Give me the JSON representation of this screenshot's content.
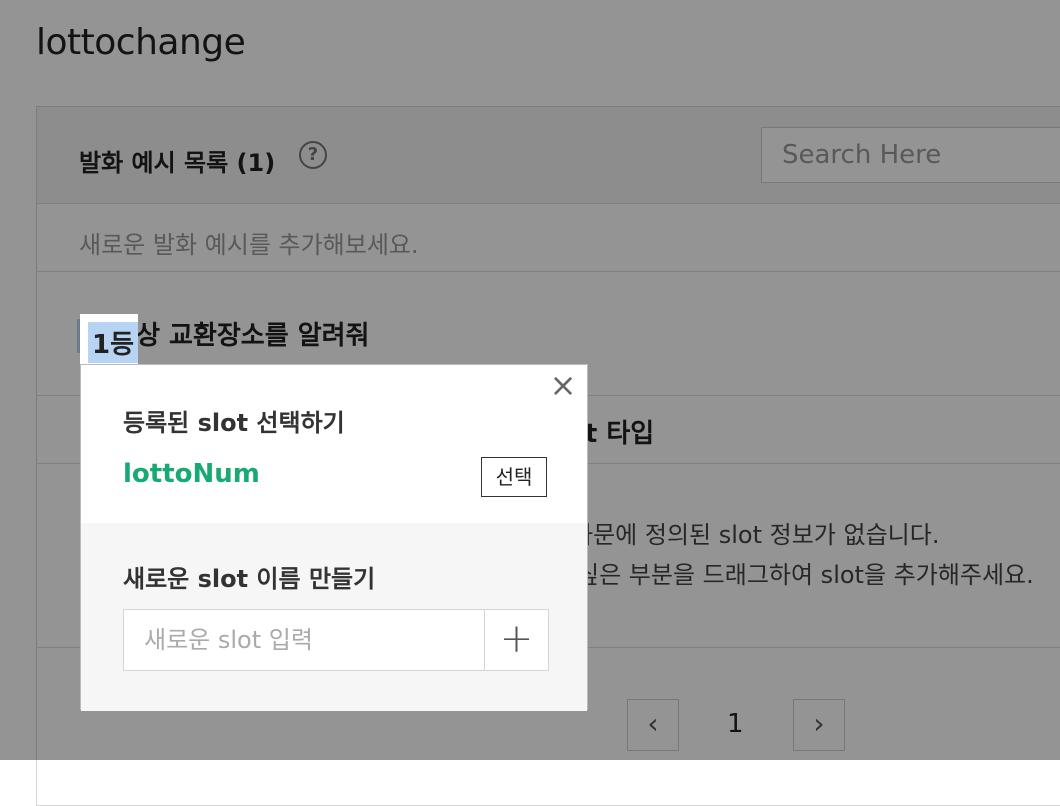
{
  "app": {
    "title": "lottochange"
  },
  "utterances": {
    "title": "발화 예시 목록 (1)",
    "help_icon": "?",
    "search_placeholder": "Search Here",
    "hint": "새로운 발화 예시를 추가해보세요.",
    "item": {
      "selected_token": "1등",
      "rest": "상 교환장소를 알려줘"
    }
  },
  "slot_table": {
    "col_slot_type": "ot 타입",
    "empty_line1": "하문에 정의된 slot 정보가 없습니다.",
    "empty_line2": "싶은 부분을 드래그하여 slot을 추가해주세요."
  },
  "pager": {
    "prev": "‹",
    "page": "1",
    "next": "›"
  },
  "popup": {
    "close": "×",
    "registered_title": "등록된 slot 선택하기",
    "slot_name": "lottoNum",
    "select_label": "선택",
    "new_title": "새로운 slot 이름 만들기",
    "new_placeholder": "새로운 slot 입력",
    "add_label": "+",
    "accent_color": "#19a974"
  }
}
